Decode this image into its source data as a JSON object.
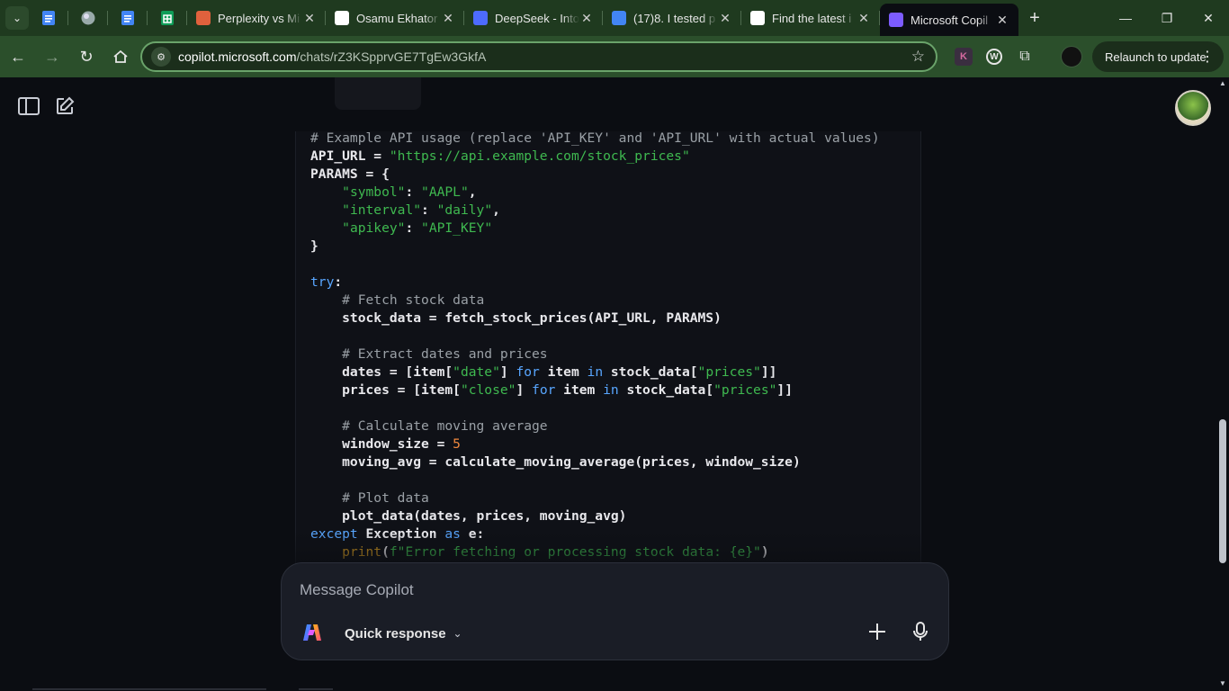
{
  "browser": {
    "tabs": [
      {
        "title": "Perplexity vs Mi",
        "favicon": "perplexity-icon",
        "color": "#e0613d"
      },
      {
        "title": "Osamu Ekhator",
        "favicon": "chatgpt-icon",
        "color": "#ffffff"
      },
      {
        "title": "DeepSeek - Into",
        "favicon": "deepseek-icon",
        "color": "#4d6bfe"
      },
      {
        "title": "(17)8. I tested p",
        "favicon": "docs-icon",
        "color": "#4285f4"
      },
      {
        "title": "Find the latest i",
        "favicon": "grok-icon",
        "color": "#ffffff"
      },
      {
        "title": "Microsoft Copil",
        "favicon": "copilot-icon",
        "color": "#7d5cff",
        "active": true
      }
    ],
    "url_domain": "copilot.microsoft.com",
    "url_path": "/chats/rZ3KSpprvGE7TgEw3GkfA",
    "relaunch_label": "Relaunch to update",
    "ext_k_label": "K",
    "ext_w_label": "W",
    "new_tab_symbol": "+",
    "close_symbol": "✕"
  },
  "composer": {
    "placeholder": "Message Copilot",
    "mode_label": "Quick response"
  },
  "code_lines": [
    [
      {
        "t": "# Example API usage (replace 'API_KEY' and 'API_URL' with actual values)",
        "c": "com"
      }
    ],
    [
      {
        "t": "API_URL = "
      },
      {
        "t": "\"https://api.example.com/stock_prices\"",
        "c": "str"
      }
    ],
    [
      {
        "t": "PARAMS = {"
      }
    ],
    [
      {
        "t": "    "
      },
      {
        "t": "\"symbol\"",
        "c": "str"
      },
      {
        "t": ": "
      },
      {
        "t": "\"AAPL\"",
        "c": "str"
      },
      {
        "t": ","
      }
    ],
    [
      {
        "t": "    "
      },
      {
        "t": "\"interval\"",
        "c": "str"
      },
      {
        "t": ": "
      },
      {
        "t": "\"daily\"",
        "c": "str"
      },
      {
        "t": ","
      }
    ],
    [
      {
        "t": "    "
      },
      {
        "t": "\"apikey\"",
        "c": "str"
      },
      {
        "t": ": "
      },
      {
        "t": "\"API_KEY\"",
        "c": "str"
      }
    ],
    [
      {
        "t": "}"
      }
    ],
    [
      {
        "t": ""
      }
    ],
    [
      {
        "t": "try",
        "c": "kw"
      },
      {
        "t": ":"
      }
    ],
    [
      {
        "t": "    "
      },
      {
        "t": "# Fetch stock data",
        "c": "com"
      }
    ],
    [
      {
        "t": "    stock_data = fetch_stock_prices(API_URL, PARAMS)"
      }
    ],
    [
      {
        "t": ""
      }
    ],
    [
      {
        "t": "    "
      },
      {
        "t": "# Extract dates and prices",
        "c": "com"
      }
    ],
    [
      {
        "t": "    dates = [item["
      },
      {
        "t": "\"date\"",
        "c": "str"
      },
      {
        "t": "] "
      },
      {
        "t": "for",
        "c": "kw"
      },
      {
        "t": " item "
      },
      {
        "t": "in",
        "c": "kw"
      },
      {
        "t": " stock_data["
      },
      {
        "t": "\"prices\"",
        "c": "str"
      },
      {
        "t": "]]"
      }
    ],
    [
      {
        "t": "    prices = [item["
      },
      {
        "t": "\"close\"",
        "c": "str"
      },
      {
        "t": "] "
      },
      {
        "t": "for",
        "c": "kw"
      },
      {
        "t": " item "
      },
      {
        "t": "in",
        "c": "kw"
      },
      {
        "t": " stock_data["
      },
      {
        "t": "\"prices\"",
        "c": "str"
      },
      {
        "t": "]]"
      }
    ],
    [
      {
        "t": ""
      }
    ],
    [
      {
        "t": "    "
      },
      {
        "t": "# Calculate moving average",
        "c": "com"
      }
    ],
    [
      {
        "t": "    window_size = "
      },
      {
        "t": "5",
        "c": "num"
      }
    ],
    [
      {
        "t": "    moving_avg = calculate_moving_average(prices, window_size)"
      }
    ],
    [
      {
        "t": ""
      }
    ],
    [
      {
        "t": "    "
      },
      {
        "t": "# Plot data",
        "c": "com"
      }
    ],
    [
      {
        "t": "    plot_data(dates, prices, moving_avg)"
      }
    ],
    [
      {
        "t": "except",
        "c": "kw"
      },
      {
        "t": " Exception "
      },
      {
        "t": "as",
        "c": "kw"
      },
      {
        "t": " e:"
      }
    ],
    [
      {
        "t": "    "
      },
      {
        "t": "print",
        "c": "fn"
      },
      {
        "t": "("
      },
      {
        "t": "f\"Error fetching or processing stock data: {e}\"",
        "c": "str"
      },
      {
        "t": ")"
      }
    ]
  ]
}
